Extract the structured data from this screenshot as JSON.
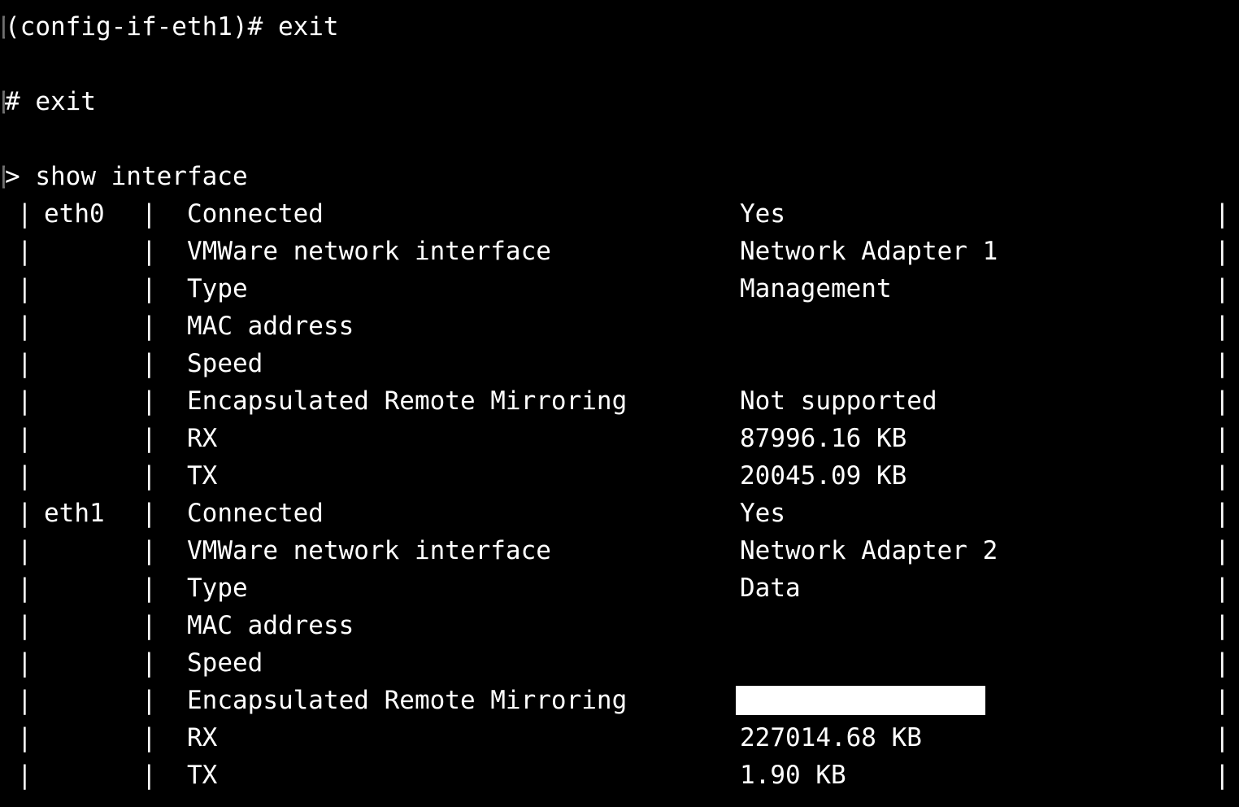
{
  "terminal": {
    "background_color": "#000000",
    "text_color": "#ffffff",
    "dim_color": "#6f6f6f",
    "prompt_stub_glyph": "[",
    "command_lines": [
      {
        "text": "(config-if-eth1)# exit"
      },
      {
        "text": "# exit"
      },
      {
        "text": "> show interface"
      }
    ]
  },
  "table": {
    "pipe": "|",
    "blank_value": "",
    "interfaces": [
      {
        "name": "eth0",
        "rows": [
          {
            "property": "Connected",
            "value": "Yes"
          },
          {
            "property": "VMWare network interface",
            "value": "Network Adapter 1"
          },
          {
            "property": "Type",
            "value": "Management"
          },
          {
            "property": "MAC address",
            "value": ""
          },
          {
            "property": "Speed",
            "value": ""
          },
          {
            "property": "Encapsulated Remote Mirroring",
            "value": "Not supported"
          },
          {
            "property": "RX",
            "value": "87996.16 KB"
          },
          {
            "property": "TX",
            "value": "20045.09 KB"
          }
        ]
      },
      {
        "name": "eth1",
        "rows": [
          {
            "property": "Connected",
            "value": "Yes"
          },
          {
            "property": "VMWare network interface",
            "value": "Network Adapter 2"
          },
          {
            "property": "Type",
            "value": "Data"
          },
          {
            "property": "MAC address",
            "value": ""
          },
          {
            "property": "Speed",
            "value": ""
          },
          {
            "property": "Encapsulated Remote Mirroring",
            "value": "",
            "redacted": true
          },
          {
            "property": "RX",
            "value": "227014.68 KB"
          },
          {
            "property": "TX",
            "value": "1.90 KB"
          }
        ]
      }
    ]
  }
}
